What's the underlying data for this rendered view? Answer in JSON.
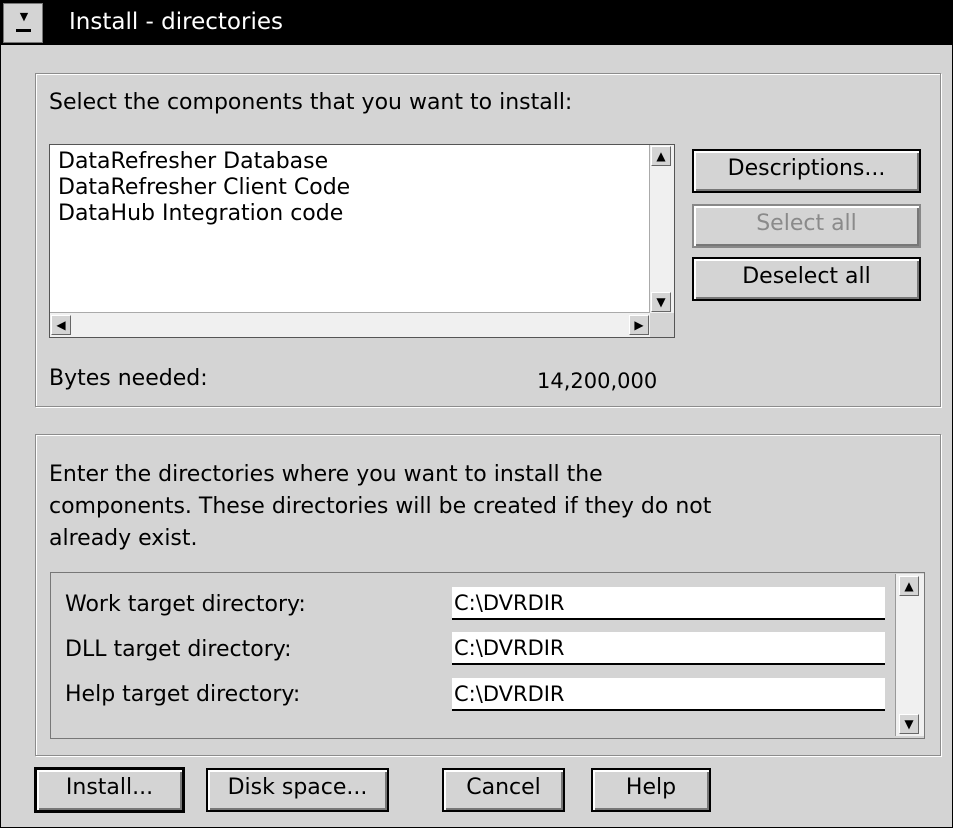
{
  "window": {
    "title": "Install - directories"
  },
  "components": {
    "prompt": "Select the components that you want to install:",
    "items": [
      "DataRefresher Database",
      "DataRefresher Client Code",
      "DataHub Integration code"
    ],
    "bytes_label": "Bytes needed:",
    "bytes_value": "14,200,000",
    "buttons": {
      "descriptions": {
        "label": "Descriptions...",
        "mnemonic": "D",
        "enabled": true
      },
      "select_all": {
        "label": "Select all",
        "mnemonic": "S",
        "enabled": false
      },
      "deselect_all": {
        "label": "Deselect all",
        "mnemonic": "l",
        "enabled": true
      }
    }
  },
  "directories": {
    "instructions_line1": "Enter the directories where you want to install the",
    "instructions_line2": "components.  These directories will be created if they do not",
    "instructions_line3": "already exist.",
    "rows": [
      {
        "label": "Work target directory:",
        "value": "C:\\DVRDIR"
      },
      {
        "label": "DLL target directory:",
        "value": "C:\\DVRDIR"
      },
      {
        "label": "Help target directory:",
        "value": "C:\\DVRDIR"
      }
    ]
  },
  "footer": {
    "install": {
      "label": "Install...",
      "mnemonic": "I"
    },
    "disk_space": {
      "label": "Disk space...",
      "mnemonic": "k"
    },
    "cancel": {
      "label": "Cancel"
    },
    "help": {
      "label": "Help"
    }
  },
  "icons": {
    "system_menu": "system-menu-icon",
    "scroll_up": "up-arrow-icon",
    "scroll_down": "down-arrow-icon",
    "scroll_left": "left-arrow-icon",
    "scroll_right": "right-arrow-icon"
  }
}
